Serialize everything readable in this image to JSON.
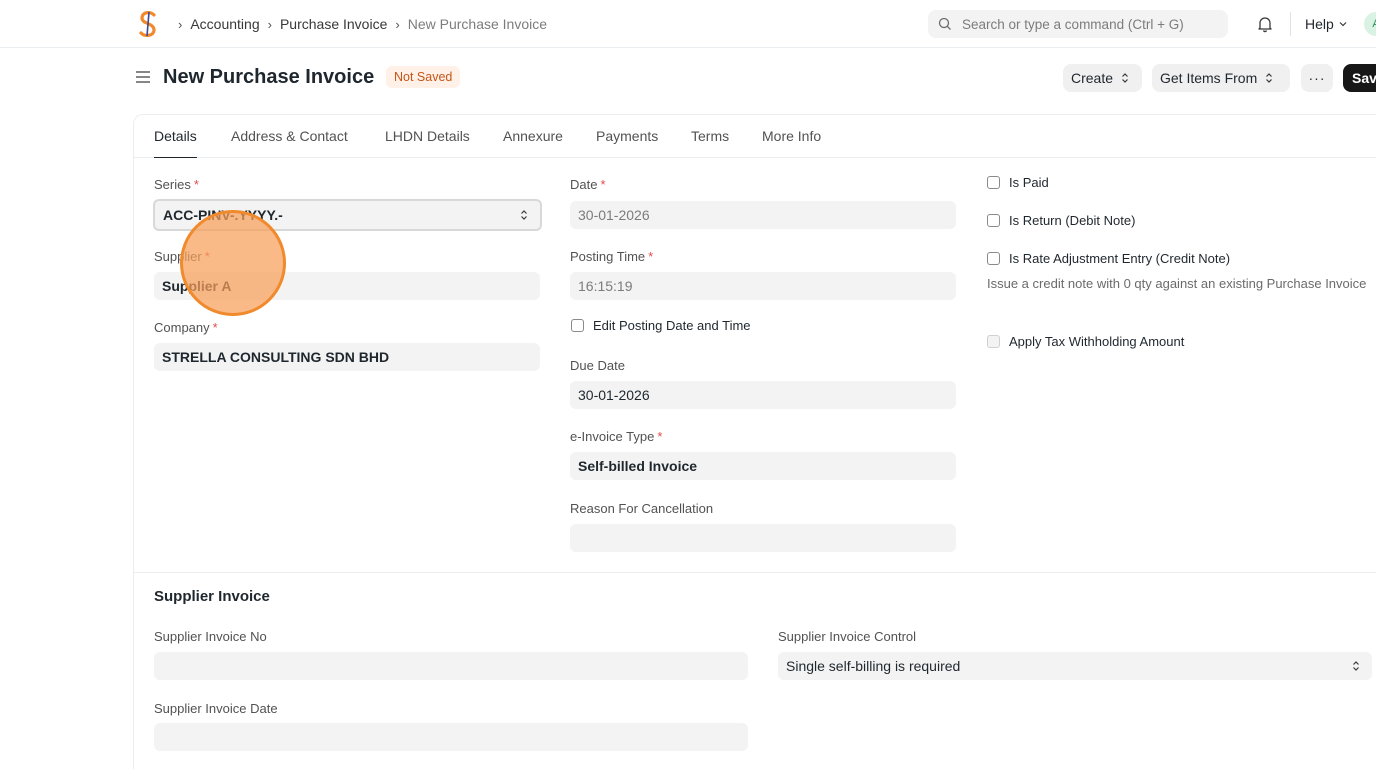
{
  "navbar": {
    "breadcrumbs": [
      "Accounting",
      "Purchase Invoice",
      "New Purchase Invoice"
    ],
    "search_placeholder": "Search or type a command (Ctrl + G)",
    "help_label": "Help",
    "avatar_initial": "A"
  },
  "page": {
    "title": "New Purchase Invoice",
    "status": "Not Saved",
    "create_label": "Create",
    "get_items_label": "Get Items From",
    "more_label": "···",
    "save_label": "Save"
  },
  "tabs": [
    "Details",
    "Address & Contact",
    "LHDN Details",
    "Annexure",
    "Payments",
    "Terms",
    "More Info"
  ],
  "col1": {
    "series_label": "Series",
    "series_value": "ACC-PINV-.YYYY.-",
    "supplier_label": "Supplier",
    "supplier_value": "Supplier A",
    "company_label": "Company",
    "company_value": "STRELLA CONSULTING SDN BHD"
  },
  "col2": {
    "date_label": "Date",
    "date_value": "30-01-2026",
    "posting_time_label": "Posting Time",
    "posting_time_value": "16:15:19",
    "edit_posting_label": "Edit Posting Date and Time",
    "due_date_label": "Due Date",
    "due_date_value": "30-01-2026",
    "einvoice_type_label": "e-Invoice Type",
    "einvoice_type_value": "Self-billed Invoice",
    "reason_label": "Reason For Cancellation",
    "reason_value": ""
  },
  "col3": {
    "is_paid_label": "Is Paid",
    "is_return_label": "Is Return (Debit Note)",
    "is_rate_adj_label": "Is Rate Adjustment Entry (Credit Note)",
    "rate_adj_help": "Issue a credit note with 0 qty against an existing Purchase Invoice",
    "apply_tax_label": "Apply Tax Withholding Amount"
  },
  "supplier_invoice": {
    "section_title": "Supplier Invoice",
    "no_label": "Supplier Invoice No",
    "no_value": "",
    "control_label": "Supplier Invoice Control",
    "control_value": "Single self-billing is required",
    "date_label": "Supplier Invoice Date",
    "date_value": ""
  }
}
